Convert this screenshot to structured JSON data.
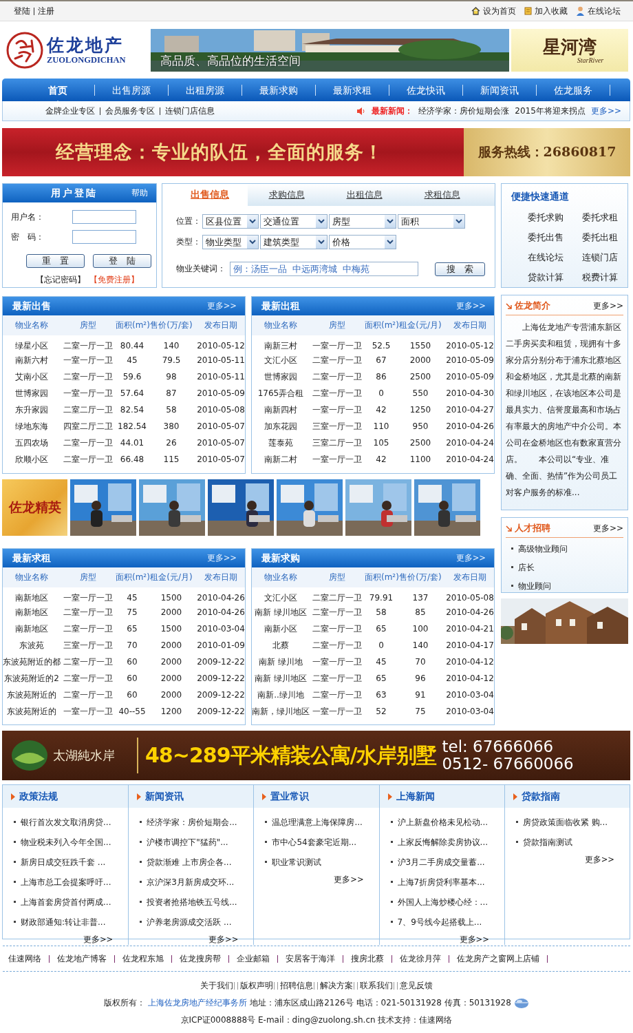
{
  "top_bar": {
    "left_links": [
      "登陆",
      "注册"
    ],
    "right_links": [
      "设为首页",
      "加入收藏",
      "在线论坛"
    ]
  },
  "logo": {
    "name": "佐龙地产",
    "latin": "ZUOLONGDICHAN"
  },
  "header_banner": {
    "caption": "高品质、高品位的生活空间",
    "brand": "星河湾",
    "brand_latin": "StarRiver"
  },
  "nav": [
    {
      "label": "首页",
      "selected": true
    },
    {
      "label": "出售房源",
      "selected": false
    },
    {
      "label": "出租房源",
      "selected": false
    },
    {
      "label": "最新求购",
      "selected": false
    },
    {
      "label": "最新求租",
      "selected": false
    },
    {
      "label": "佐龙快讯",
      "selected": false
    },
    {
      "label": "新闻资讯",
      "selected": false
    },
    {
      "label": "佐龙服务",
      "selected": false
    }
  ],
  "sub_nav": {
    "links": [
      "金牌企业专区",
      "会员服务专区",
      "连锁门店信息"
    ],
    "news_label": "最新新闻：",
    "news": [
      "经济学家：房价短期会涨",
      "2015年将迎来拐点"
    ],
    "more": "更多>>"
  },
  "slogan_banner": {
    "slogan": "经营理念：专业的队伍，全面的服务！",
    "hotline": "服务热线：26860817"
  },
  "login": {
    "title": "用户登陆",
    "help": "帮助",
    "fields": [
      {
        "label": "用户名："
      },
      {
        "label": "密　码："
      }
    ],
    "buttons": [
      "重　置",
      "登　陆"
    ],
    "forgot": "【忘记密码】",
    "register": "【免费注册】"
  },
  "search": {
    "tabs": [
      {
        "label": "出售信息",
        "selected": true
      },
      {
        "label": "求购信息",
        "selected": false
      },
      {
        "label": "出租信息",
        "selected": false
      },
      {
        "label": "求租信息",
        "selected": false
      }
    ],
    "rows": [
      {
        "label": "位置：",
        "selects": [
          "区县位置",
          "交通位置",
          "房型",
          "面积"
        ]
      },
      {
        "label": "类型：",
        "selects": [
          "物业类型",
          "建筑类型",
          "价格"
        ]
      }
    ],
    "keyword_label": "物业关键词：",
    "placeholder": "例：汤臣一品  中远两湾城  中梅苑",
    "button": "搜　索"
  },
  "quick_links": {
    "title": "便捷快速通道",
    "items": [
      "委托求购",
      "委托求租",
      "委托出售",
      "委托出租",
      "在线论坛",
      "连锁门店",
      "贷款计算",
      "税费计算"
    ]
  },
  "listings_top": [
    {
      "title": "最新出售",
      "more": "更多>>",
      "columns": [
        "物业名称",
        "房型",
        "面积(m²)",
        "售价(万/套)",
        "发布日期"
      ],
      "rows": [
        [
          "绿星小区",
          "二室一厅一卫",
          "80.44",
          "140",
          "2010-05-12"
        ],
        [
          "南新六村",
          "一室一厅一卫",
          "45",
          "79.5",
          "2010-05-11"
        ],
        [
          "艾南小区",
          "二室一厅一卫",
          "59.6",
          "98",
          "2010-05-11"
        ],
        [
          "世博家园",
          "一室一厅一卫",
          "57.64",
          "87",
          "2010-05-09"
        ],
        [
          "东升家园",
          "二室二厅一卫",
          "82.54",
          "58",
          "2010-05-08"
        ],
        [
          "绿地东海",
          "四室二厅二卫",
          "182.54",
          "380",
          "2010-05-07"
        ],
        [
          "五四农场",
          "二室一厅一卫",
          "44.01",
          "26",
          "2010-05-07"
        ],
        [
          "欣顺小区",
          "二室一厅一卫",
          "66.48",
          "115",
          "2010-05-07"
        ]
      ]
    },
    {
      "title": "最新出租",
      "more": "更多>>",
      "columns": [
        "物业名称",
        "房型",
        "面积(m²)",
        "租金(元/月)",
        "发布日期"
      ],
      "rows": [
        [
          "南新三村",
          "一室一厅一卫",
          "52.5",
          "1550",
          "2010-05-12"
        ],
        [
          "文汇小区",
          "二室一厅一卫",
          "67",
          "2000",
          "2010-05-09"
        ],
        [
          "世博家园",
          "二室一厅一卫",
          "86",
          "2500",
          "2010-05-09"
        ],
        [
          "1765弄合租",
          "二室一厅一卫",
          "0",
          "550",
          "2010-04-30"
        ],
        [
          "南新四村",
          "一室一厅一卫",
          "42",
          "1250",
          "2010-04-27"
        ],
        [
          "加东花园",
          "三室一厅一卫",
          "110",
          "950",
          "2010-04-26"
        ],
        [
          "莲泰苑",
          "三室二厅一卫",
          "105",
          "2500",
          "2010-04-24"
        ],
        [
          "南新二村",
          "一室一厅一卫",
          "42",
          "1100",
          "2010-04-24"
        ]
      ]
    }
  ],
  "photo_strip": {
    "caption": "佐龙精英"
  },
  "listings_bottom": [
    {
      "title": "最新求租",
      "more": "更多>>",
      "columns": [
        "物业名称",
        "房型",
        "面积(m²)",
        "租金(元/月)",
        "发布日期"
      ],
      "rows": [
        [
          "南新地区",
          "一室一厅一卫",
          "45",
          "1500",
          "2010-04-26"
        ],
        [
          "南新地区",
          "二室一厅一卫",
          "75",
          "2000",
          "2010-04-26"
        ],
        [
          "南新地区",
          "二室一厅一卫",
          "65",
          "1500",
          "2010-03-04"
        ],
        [
          "东波苑",
          "三室一厅一卫",
          "70",
          "2000",
          "2010-01-09"
        ],
        [
          "东波苑附近的都",
          "二室一厅一卫",
          "60",
          "2000",
          "2009-12-22"
        ],
        [
          "东波苑附近的2",
          "二室一厅一卫",
          "60",
          "2000",
          "2009-12-22"
        ],
        [
          "东波苑附近的",
          "二室一厅一卫",
          "60",
          "2000",
          "2009-12-22"
        ],
        [
          "东波苑附近的",
          "一室一厅一卫",
          "40--55",
          "1200",
          "2009-12-22"
        ]
      ]
    },
    {
      "title": "最新求购",
      "more": "更多>>",
      "columns": [
        "物业名称",
        "房型",
        "面积(m²)",
        "售价(万/套)",
        "发布日期"
      ],
      "rows": [
        [
          "文汇小区",
          "二室二厅一卫",
          "79.91",
          "137",
          "2010-05-08"
        ],
        [
          "南新  绿川地区",
          "二室一厅一卫",
          "58",
          "85",
          "2010-04-26"
        ],
        [
          "南新小区",
          "二室一厅一卫",
          "65",
          "100",
          "2010-04-21"
        ],
        [
          "北蔡",
          "二室一厅一卫",
          "0",
          "140",
          "2010-04-17"
        ],
        [
          "南新  绿川地",
          "一室一厅一卫",
          "45",
          "70",
          "2010-04-12"
        ],
        [
          "南新  绿川地区",
          "二室一厅一卫",
          "65",
          "96",
          "2010-04-12"
        ],
        [
          "南新..绿川地",
          "二室一厅一卫",
          "63",
          "91",
          "2010-03-04"
        ],
        [
          "南新，绿川地区",
          "一室一厅一卫",
          "52",
          "75",
          "2010-03-04"
        ]
      ]
    }
  ],
  "intro": {
    "title": "佐龙简介",
    "more": "更多>>",
    "text": "上海佐龙地产专营浦东新区二手房买卖和租赁，现拥有十多家分店分别分布于浦东北蔡地区和金桥地区，尤其是北蔡的南新和绿川地区，在该地区本公司是最具实力、信誉度最高和市场占有率最大的房地产中介公司。本公司在金桥地区也有数家直营分店。　　本公司以“专业、准确、全面、热情”作为公司员工对客户服务的标准..."
  },
  "jobs": {
    "title": "人才招聘",
    "more": "更多>>",
    "items": [
      "高级物业顾问",
      "店长",
      "物业顾问"
    ]
  },
  "ad_banner": {
    "brand": "太湖純水岸",
    "headline": "48~289平米精装公寓/水岸别墅",
    "tel_lines": [
      "tel: 67666066",
      "0512- 67660066"
    ]
  },
  "news_columns": [
    {
      "title": "政策法规",
      "items": [
        "银行首次发文取消房贷...",
        "物业税未列入今年全国...",
        "新房日成交狂跌千套  ...",
        "上海市总工会提案呼吁...",
        "上海首套房贷首付两成...",
        "财政部通知:转让非普..."
      ],
      "more": "更多>>"
    },
    {
      "title": "新闻资讯",
      "items": [
        "经济学家：房价短期会...",
        "沪楼市调控下\"猛药\"...",
        "贷款渐难  上市房企各...",
        "京沪深3月新房成交环...",
        "投资者抢搭地铁五号线...",
        "沪养老房源成交活跃  ..."
      ],
      "more": "更多>>"
    },
    {
      "title": "置业常识",
      "items": [
        "温总理满意上海保障房...",
        "市中心54套豪宅近期...",
        "职业常识测试"
      ],
      "more": "更多>>"
    },
    {
      "title": "上海新闻",
      "items": [
        "沪上新盘价格未见松动...",
        "上家反悔解除卖房协议...",
        "沪3月二手房成交量蓄...",
        "上海7折房贷利率基本...",
        "外国人上海炒楼心经：...",
        "7、9号线今起搭载上..."
      ],
      "more": "更多>>"
    },
    {
      "title": "贷款指南",
      "items": [
        "房贷政策面临收紧  购...",
        "贷款指南测试"
      ],
      "more": "更多>>"
    }
  ],
  "partner_links": [
    "佳速网络",
    "佐龙地产博客",
    "佐龙程东旭",
    "佐龙搜房帮",
    "企业邮箱",
    "安居客于海洋",
    "搜房北蔡",
    "佐龙徐月萍",
    "佐龙房产之窗网上店铺"
  ],
  "footer": {
    "links": [
      "关于我们",
      "版权声明",
      "招聘信息",
      "解决方案",
      "联系我们",
      "意见反馈"
    ],
    "copyright_label": "版权所有：",
    "company": "上海佐龙房地产经纪事务所",
    "contact": "地址：浦东区成山路2126号  电话：021-50131928 传真：50131928",
    "icp": "京ICP证0008888号  E-mail：ding@zuolong.sh.cn 技术支持：佳速网络"
  }
}
